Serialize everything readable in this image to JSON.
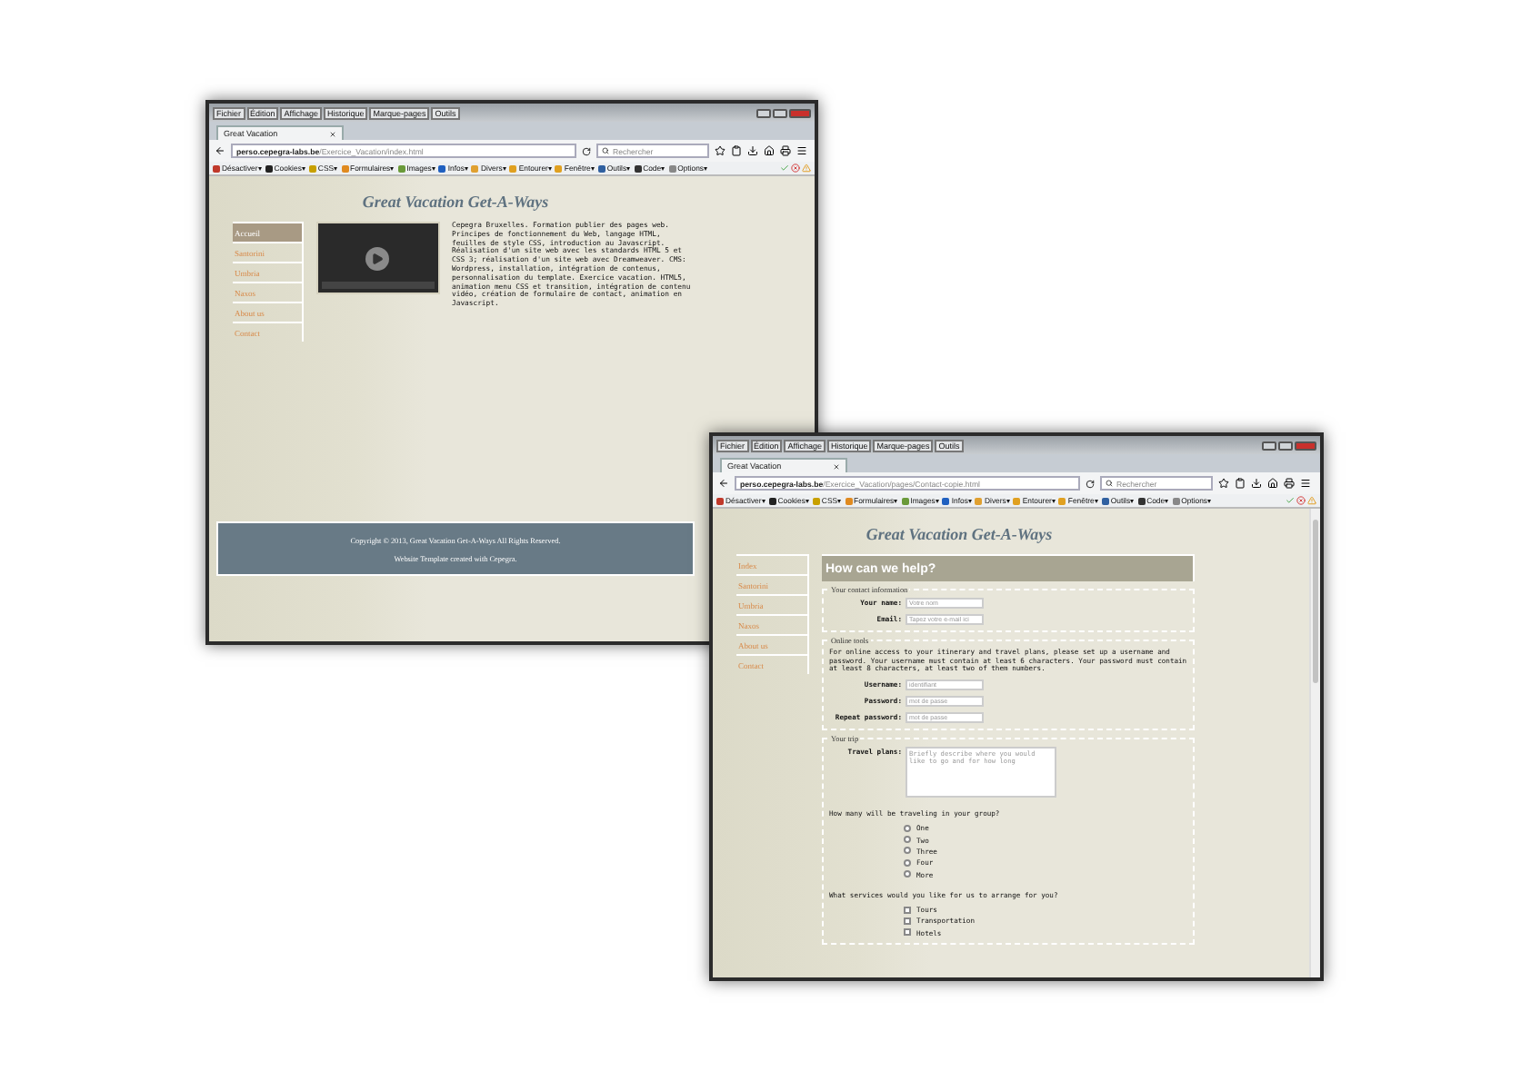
{
  "windows": [
    {
      "menu": [
        "Fichier",
        "Édition",
        "Affichage",
        "Historique",
        "Marque-pages",
        "Outils"
      ],
      "tab": "Great Vacation",
      "url_host": "perso.cepegra-labs.be",
      "url_path": "/Exercice_Vacation/index.html",
      "search_placeholder": "Rechercher",
      "toolbar": [
        "Désactiver▾",
        "Cookies▾",
        "CSS▾",
        "Formulaires▾",
        "Images▾",
        "Infos▾",
        "Divers▾",
        "Entourer▾",
        "Fenêtre▾",
        "Outils▾",
        "Code▾",
        "Options▾"
      ],
      "page": {
        "kind": "home",
        "heading": "Great Vacation Get-A-Ways",
        "nav": [
          {
            "label": "Accueil",
            "selected": true
          },
          {
            "label": "Santorini",
            "selected": false
          },
          {
            "label": "Umbria",
            "selected": false
          },
          {
            "label": "Naxos",
            "selected": false
          },
          {
            "label": "About us",
            "selected": false
          },
          {
            "label": "Contact",
            "selected": false
          }
        ],
        "text": "Cepegra Bruxelles. Formation publier des pages web. Principes de fonctionnement du Web, langage HTML, feuilles de style CSS, introduction au Javascript. Réalisation d'un site web avec les standards HTML 5 et CSS 3; réalisation d'un site web avec Dreamweaver. CMS: Wordpress, installation, intégration de contenus, personnalisation du template. Exercice vacation. HTML5, animation menu CSS et transition, intégration de contenu vidéo, création de formulaire de contact, animation en Javascript.",
        "footer": [
          "Copyright © 2013, Great Vacation Get-A-Ways All Rights Reserved.",
          "Website Template created with Cepegra."
        ]
      }
    },
    {
      "menu": [
        "Fichier",
        "Édition",
        "Affichage",
        "Historique",
        "Marque-pages",
        "Outils"
      ],
      "tab": "Great Vacation",
      "url_host": "perso.cepegra-labs.be",
      "url_path": "/Exercice_Vacation/pages/Contact-copie.html",
      "search_placeholder": "Rechercher",
      "toolbar": [
        "Désactiver▾",
        "Cookies▾",
        "CSS▾",
        "Formulaires▾",
        "Images▾",
        "Infos▾",
        "Divers▾",
        "Entourer▾",
        "Fenêtre▾",
        "Outils▾",
        "Code▾",
        "Options▾"
      ],
      "page": {
        "kind": "contact",
        "heading": "Great Vacation Get-A-Ways",
        "nav": [
          {
            "label": "Index",
            "selected": false
          },
          {
            "label": "Santorini",
            "selected": false
          },
          {
            "label": "Umbria",
            "selected": false
          },
          {
            "label": "Naxos",
            "selected": false
          },
          {
            "label": "About us",
            "selected": false
          },
          {
            "label": "Contact",
            "selected": false
          }
        ],
        "form_title": "How can we help?",
        "sections": [
          {
            "legend": "Your contact information",
            "fields": [
              {
                "kind": "text",
                "label": "Your name:",
                "placeholder": "Votre nom"
              },
              {
                "kind": "text",
                "label": "Email:",
                "placeholder": "Tapez votre e-mail ici"
              }
            ]
          },
          {
            "legend": "Online tools",
            "intro": "For online access to your itinerary and travel plans, please set up a username and password. Your username must contain at least 6 characters. Your password must contain at least 8 characters, at least two of them numbers.",
            "fields": [
              {
                "kind": "text",
                "label": "Username:",
                "placeholder": "identifiant"
              },
              {
                "kind": "text",
                "label": "Password:",
                "placeholder": "mot de passe"
              },
              {
                "kind": "text",
                "label": "Repeat password:",
                "placeholder": "mot de passe"
              }
            ]
          },
          {
            "legend": "Your trip",
            "fields": [
              {
                "kind": "textarea",
                "label": "Travel plans:",
                "placeholder": "Briefly describe where you would like to go and for how long"
              }
            ],
            "questions": [
              {
                "kind": "radio",
                "text": "How many will be traveling in your group?",
                "options": [
                  {
                    "label": "One",
                    "selected": false
                  },
                  {
                    "label": "Two",
                    "selected": false
                  },
                  {
                    "label": "Three",
                    "selected": false
                  },
                  {
                    "label": "Four",
                    "selected": false
                  },
                  {
                    "label": "More",
                    "selected": false
                  }
                ]
              },
              {
                "kind": "checkbox",
                "text": "What services would you like for us to arrange for you?",
                "options": [
                  {
                    "label": "Tours",
                    "checked": false
                  },
                  {
                    "label": "Transportation",
                    "checked": false
                  },
                  {
                    "label": "Hotels",
                    "checked": false
                  }
                ]
              }
            ]
          }
        ]
      }
    }
  ]
}
